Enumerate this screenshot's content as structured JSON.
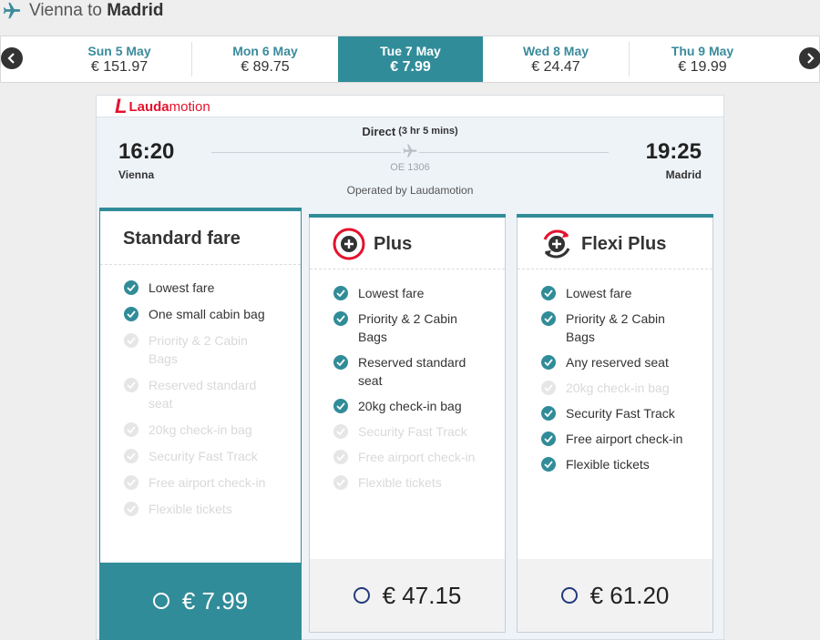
{
  "header": {
    "from": "Vienna",
    "connector": "to",
    "to": "Madrid",
    "icon": "plane-icon"
  },
  "dates": [
    {
      "label": "Sun 5 May",
      "price": "€ 151.97",
      "active": false
    },
    {
      "label": "Mon 6 May",
      "price": "€ 89.75",
      "active": false
    },
    {
      "label": "Tue 7 May",
      "price": "€ 7.99",
      "active": true
    },
    {
      "label": "Wed 8 May",
      "price": "€ 24.47",
      "active": false
    },
    {
      "label": "Thu 9 May",
      "price": "€ 19.99",
      "active": false
    }
  ],
  "flight": {
    "airline_part1": "Lauda",
    "airline_part2": "motion",
    "departure_time": "16:20",
    "departure_city": "Vienna",
    "arrival_time": "19:25",
    "arrival_city": "Madrid",
    "stops": "Direct",
    "duration": "(3 hr 5 mins)",
    "flight_number": "OE 1306",
    "operated_by": "Operated by Laudamotion"
  },
  "fares": [
    {
      "name": "Standard fare",
      "price": "€ 7.99",
      "selected": true,
      "features": [
        {
          "text": "Lowest fare",
          "included": true
        },
        {
          "text": "One small cabin bag",
          "included": true
        },
        {
          "text": "Priority & 2 Cabin Bags",
          "included": false
        },
        {
          "text": "Reserved standard seat",
          "included": false
        },
        {
          "text": "20kg check-in bag",
          "included": false
        },
        {
          "text": "Security Fast Track",
          "included": false
        },
        {
          "text": "Free airport check-in",
          "included": false
        },
        {
          "text": "Flexible tickets",
          "included": false
        }
      ]
    },
    {
      "name": "Plus",
      "price": "€ 47.15",
      "selected": false,
      "icon": "plus-fare-icon",
      "features": [
        {
          "text": "Lowest fare",
          "included": true
        },
        {
          "text": "Priority & 2 Cabin Bags",
          "included": true
        },
        {
          "text": "Reserved standard seat",
          "included": true
        },
        {
          "text": "20kg check-in bag",
          "included": true
        },
        {
          "text": "Security Fast Track",
          "included": false
        },
        {
          "text": "Free airport check-in",
          "included": false
        },
        {
          "text": "Flexible tickets",
          "included": false
        }
      ]
    },
    {
      "name": "Flexi Plus",
      "price": "€ 61.20",
      "selected": false,
      "icon": "flexi-plus-fare-icon",
      "features": [
        {
          "text": "Lowest fare",
          "included": true
        },
        {
          "text": "Priority & 2 Cabin Bags",
          "included": true
        },
        {
          "text": "Any reserved seat",
          "included": true
        },
        {
          "text": "20kg check-in bag",
          "included": false
        },
        {
          "text": "Security Fast Track",
          "included": true
        },
        {
          "text": "Free airport check-in",
          "included": true
        },
        {
          "text": "Flexible tickets",
          "included": true
        }
      ]
    }
  ],
  "colors": {
    "accent": "#318c99",
    "brand_red": "#e4122d",
    "included": "#318c99",
    "excluded": "#e6e6e6"
  }
}
